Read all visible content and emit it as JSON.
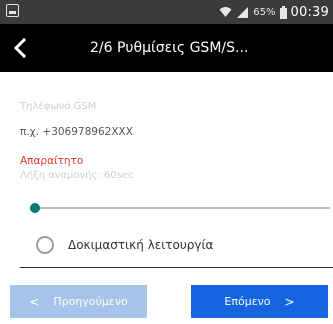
{
  "status_bar": {
    "battery_percent": "65%",
    "time": "00:39"
  },
  "toolbar": {
    "title": "2/6 Ρυθμίσεις GSM/S..."
  },
  "form": {
    "phone_label": "Τηλέφωνο GSM",
    "phone_placeholder": "π.χ. +306978962XXX",
    "phone_value": "",
    "error_text": "Απαραίτητο",
    "timeout_label": "Λήξη αναμονής: 60sec",
    "timeout_slider_fraction": 0,
    "test_mode_label": "Δοκιμαστική λειτουργία",
    "test_mode_checked": false
  },
  "buttons": {
    "prev_label": "Προηγούμενο",
    "next_label": "Επόμενο"
  },
  "colors": {
    "status_bar": "#3b3b3b",
    "toolbar": "#000000",
    "error": "#e53935",
    "slider_thumb": "#0b7a6c",
    "prev_button": "#a6c3ea",
    "next_button": "#1565e0"
  },
  "icons": {
    "status_left": "notification-icon",
    "wifi": "wifi-icon",
    "signal": "signal-icon",
    "battery": "battery-icon",
    "back": "back-arrow-icon",
    "radio": "radio-button-icon",
    "prev_chevron": "chevron-left-icon",
    "next_chevron": "chevron-right-icon"
  }
}
